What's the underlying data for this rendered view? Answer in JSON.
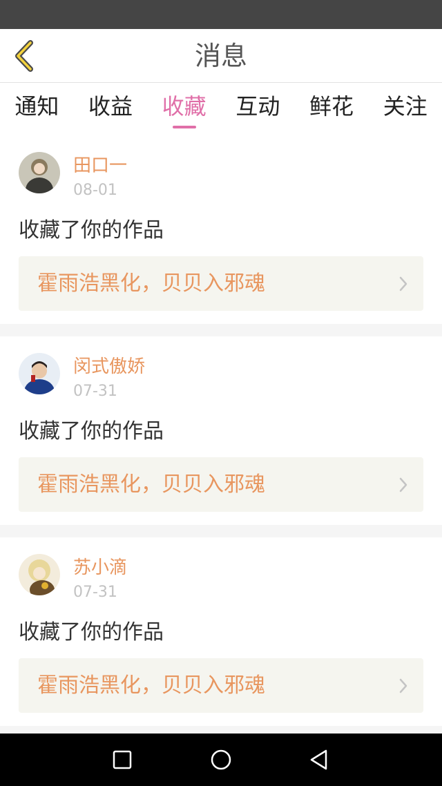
{
  "header": {
    "title": "消息",
    "back_icon": "chevron-left-icon"
  },
  "tabs": [
    {
      "label": "通知",
      "active": false
    },
    {
      "label": "收益",
      "active": false
    },
    {
      "label": "收藏",
      "active": true
    },
    {
      "label": "互动",
      "active": false
    },
    {
      "label": "鲜花",
      "active": false
    },
    {
      "label": "关注",
      "active": false
    }
  ],
  "messages": [
    {
      "user": "田口一",
      "date": "08-01",
      "action": "收藏了你的作品",
      "work_title": "霍雨浩黑化，贝贝入邪魂",
      "avatar_color": "#6b6a5a"
    },
    {
      "user": "闵式傲娇",
      "date": "07-31",
      "action": "收藏了你的作品",
      "work_title": "霍雨浩黑化，贝贝入邪魂",
      "avatar_color": "#1e3e8a"
    },
    {
      "user": "苏小滴",
      "date": "07-31",
      "action": "收藏了你的作品",
      "work_title": "霍雨浩黑化，贝贝入邪魂",
      "avatar_color": "#d9c27a"
    }
  ],
  "colors": {
    "accent": "#e06fa8",
    "name": "#e8965f",
    "status_bar": "#454545",
    "nav_bar": "#000000"
  },
  "nav": {
    "square_icon": "recents-square-icon",
    "circle_icon": "home-circle-icon",
    "triangle_icon": "back-triangle-icon"
  }
}
